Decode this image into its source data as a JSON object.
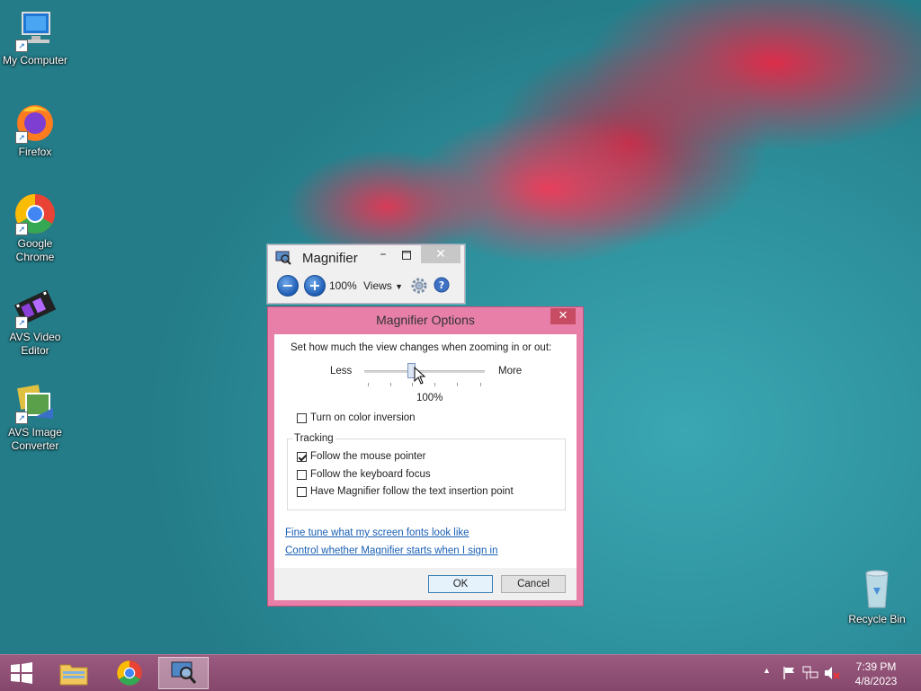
{
  "desktop": {
    "icons": [
      {
        "label": "My Computer"
      },
      {
        "label": "Firefox"
      },
      {
        "label": "Google Chrome"
      },
      {
        "label": "AVS Video Editor"
      },
      {
        "label": "AVS Image Converter"
      },
      {
        "label": "Recycle Bin"
      }
    ]
  },
  "magnifier": {
    "title": "Magnifier",
    "zoom": "100%",
    "views_label": "Views",
    "zoom_out_icon": "minus-icon",
    "zoom_in_icon": "plus-icon"
  },
  "options": {
    "title": "Magnifier Options",
    "zoom_prompt": "Set how much the view changes when zooming in or out:",
    "less_label": "Less",
    "more_label": "More",
    "slider_value": "100%",
    "color_inversion_label": "Turn on color inversion",
    "tracking_label": "Tracking",
    "follow_mouse_label": "Follow the mouse pointer",
    "follow_keyboard_label": "Follow the keyboard focus",
    "follow_text_label": "Have Magnifier follow the text insertion point",
    "fonts_link": "Fine tune what my screen fonts look like",
    "signin_link": "Control whether Magnifier starts when I sign in",
    "ok_label": "OK",
    "cancel_label": "Cancel"
  },
  "taskbar": {
    "time": "7:39 PM",
    "date": "4/8/2023"
  },
  "colors": {
    "accent": "#e77fa8",
    "taskbar": "#8f4f75",
    "link": "#1a5fb4"
  }
}
